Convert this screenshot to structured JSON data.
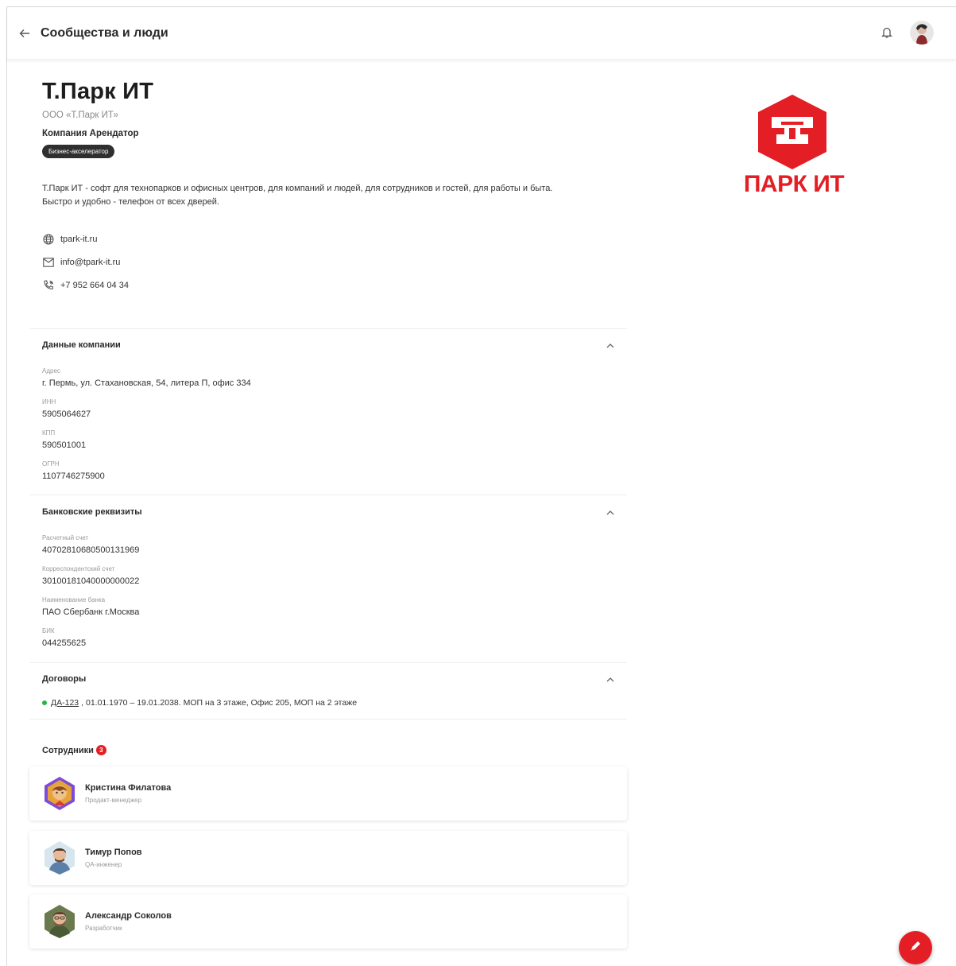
{
  "header": {
    "title": "Сообщества и люди"
  },
  "company": {
    "name": "Т.Парк ИТ",
    "legal_name": "ООО «Т.Парк ИТ»",
    "type": "Компания Арендатор",
    "tag": "Бизнес-акселератор",
    "description_line1": "Т.Парк ИТ - софт для технопарков и офисных центров, для компаний и людей, для сотрудников и гостей, для работы и быта.",
    "description_line2": "Быстро и удобно - телефон от всех дверей.",
    "website": "tpark-it.ru",
    "email": "info@tpark-it.ru",
    "phone": "+7 952 664 04 34",
    "logo_text": "ПАРК ИТ",
    "brand_color": "#e31e24"
  },
  "sections": {
    "company_data": {
      "title": "Данные компании",
      "fields": [
        {
          "label": "Адрес",
          "value": "г. Пермь, ул. Стахановская, 54, литера П, офис 334"
        },
        {
          "label": "ИНН",
          "value": "5905064627"
        },
        {
          "label": "КПП",
          "value": "590501001"
        },
        {
          "label": "ОГРН",
          "value": "1107746275900"
        }
      ]
    },
    "bank": {
      "title": "Банковские реквизиты",
      "fields": [
        {
          "label": "Расчетный счет",
          "value": "40702810680500131969"
        },
        {
          "label": "Корреспондентский счет",
          "value": "30100181040000000022"
        },
        {
          "label": "Наименование банка",
          "value": "ПАО Сбербанк г.Москва"
        },
        {
          "label": "БИК",
          "value": "044255625"
        }
      ]
    },
    "contracts": {
      "title": "Договоры",
      "items": [
        {
          "number": "ДА-123",
          "details": ", 01.01.1970 – 19.01.2038. МОП на 3 этаже, Офис 205, МОП на 2 этаже"
        }
      ]
    },
    "employees": {
      "title": "Сотрудники",
      "count": "3",
      "items": [
        {
          "name": "Кристина Филатова",
          "role": "Продакт-менеджер"
        },
        {
          "name": "Тимур Попов",
          "role": "QA-инженер"
        },
        {
          "name": "Александр Соколов",
          "role": "Разработчик"
        }
      ]
    }
  }
}
